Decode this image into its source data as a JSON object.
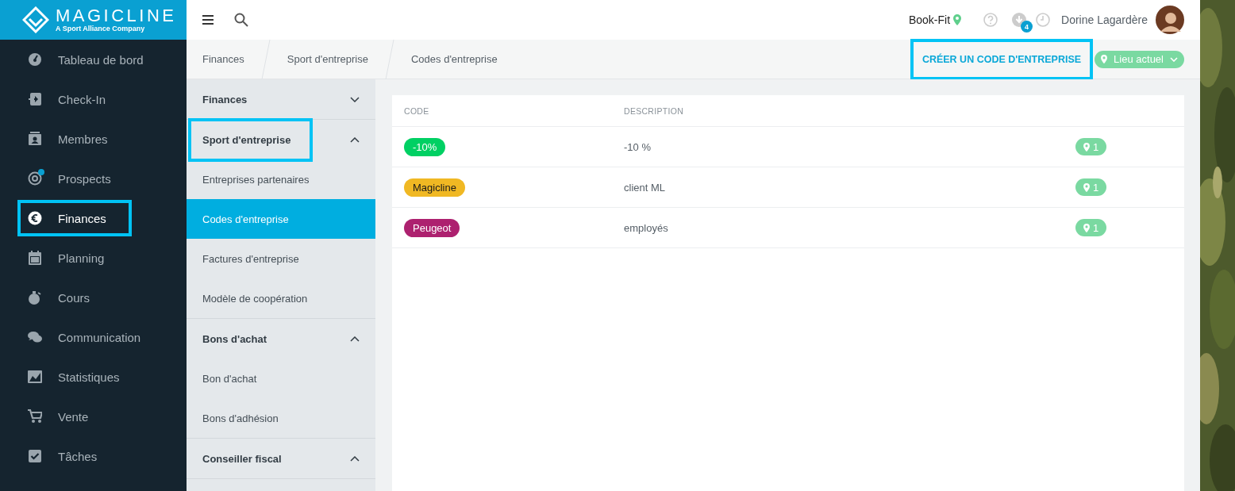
{
  "logo": {
    "name": "MAGICLINE",
    "tagline": "A Sport Alliance Company"
  },
  "sidebar": {
    "items": [
      {
        "label": "Tableau de bord",
        "selected": false,
        "highlighted": false,
        "notification": false
      },
      {
        "label": "Check-In",
        "selected": false,
        "highlighted": false,
        "notification": false
      },
      {
        "label": "Membres",
        "selected": false,
        "highlighted": false,
        "notification": false
      },
      {
        "label": "Prospects",
        "selected": false,
        "highlighted": false,
        "notification": true
      },
      {
        "label": "Finances",
        "selected": true,
        "highlighted": true,
        "notification": false
      },
      {
        "label": "Planning",
        "selected": false,
        "highlighted": false,
        "notification": false
      },
      {
        "label": "Cours",
        "selected": false,
        "highlighted": false,
        "notification": false
      },
      {
        "label": "Communication",
        "selected": false,
        "highlighted": false,
        "notification": false
      },
      {
        "label": "Statistiques",
        "selected": false,
        "highlighted": false,
        "notification": false
      },
      {
        "label": "Vente",
        "selected": false,
        "highlighted": false,
        "notification": false
      },
      {
        "label": "Tâches",
        "selected": false,
        "highlighted": false,
        "notification": false
      }
    ]
  },
  "topbar": {
    "studio": "Book-Fit",
    "downloads_badge": "4",
    "user": "Dorine Lagardère"
  },
  "breadcrumb": [
    "Finances",
    "Sport d'entreprise",
    "Codes d'entreprise"
  ],
  "actions": {
    "create_button": {
      "label": "CRÉER UN CODE D'ENTREPRISE",
      "highlighted": true
    },
    "location_filter": {
      "label": "Lieu actuel"
    }
  },
  "subnav": {
    "sections": [
      {
        "title": "Finances",
        "expanded": false,
        "highlighted": false
      },
      {
        "title": "Sport d'entreprise",
        "expanded": true,
        "highlighted": true,
        "items": [
          {
            "label": "Entreprises partenaires",
            "selected": false
          },
          {
            "label": "Codes d'entreprise",
            "selected": true
          },
          {
            "label": "Factures d'entreprise",
            "selected": false
          },
          {
            "label": "Modèle de coopération",
            "selected": false
          }
        ]
      },
      {
        "title": "Bons d'achat",
        "expanded": true,
        "highlighted": false,
        "items": [
          {
            "label": "Bon d'achat",
            "selected": false
          },
          {
            "label": "Bons d'adhésion",
            "selected": false
          }
        ]
      },
      {
        "title": "Conseiller fiscal",
        "expanded": true,
        "highlighted": false
      }
    ]
  },
  "table": {
    "columns": [
      "CODE",
      "DESCRIPTION"
    ],
    "rows": [
      {
        "code": "-10%",
        "color": "#00d063",
        "description": "-10 %",
        "locations": "1"
      },
      {
        "code": "Magicline",
        "color": "#f0b823",
        "description": "client ML",
        "locations": "1"
      },
      {
        "code": "Peugeot",
        "color": "#ad216f",
        "description": "employés",
        "locations": "1"
      }
    ]
  }
}
